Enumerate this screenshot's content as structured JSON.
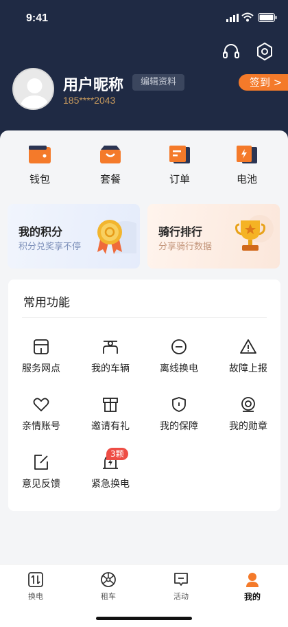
{
  "status_bar": {
    "time": "9:41"
  },
  "profile": {
    "nickname": "用户昵称",
    "edit_label": "编辑资料",
    "phone": "185****2043",
    "signin_label": "签到 >"
  },
  "quick_actions": [
    {
      "label": "钱包",
      "icon": "wallet-icon"
    },
    {
      "label": "套餐",
      "icon": "package-bag-icon"
    },
    {
      "label": "订单",
      "icon": "order-icon"
    },
    {
      "label": "电池",
      "icon": "battery-icon"
    }
  ],
  "cards": [
    {
      "title": "我的积分",
      "subtitle": "积分兑奖享不停",
      "icon": "medal-icon"
    },
    {
      "title": "骑行排行",
      "subtitle": "分享骑行数据",
      "icon": "trophy-icon"
    }
  ],
  "common": {
    "title": "常用功能",
    "items": [
      {
        "label": "服务网点",
        "icon": "store-icon"
      },
      {
        "label": "我的车辆",
        "icon": "vehicle-icon"
      },
      {
        "label": "离线换电",
        "icon": "offline-swap-icon"
      },
      {
        "label": "故障上报",
        "icon": "warning-icon"
      },
      {
        "label": "亲情账号",
        "icon": "heart-icon"
      },
      {
        "label": "邀请有礼",
        "icon": "gift-icon"
      },
      {
        "label": "我的保障",
        "icon": "shield-icon"
      },
      {
        "label": "我的勋章",
        "icon": "badge-medal-icon"
      },
      {
        "label": "意见反馈",
        "icon": "feedback-icon"
      },
      {
        "label": "紧急换电",
        "icon": "emergency-swap-icon"
      }
    ],
    "emergency_badge": "3颗"
  },
  "tabbar": [
    {
      "label": "换电",
      "icon": "swap-icon"
    },
    {
      "label": "租车",
      "icon": "wheel-icon"
    },
    {
      "label": "活动",
      "icon": "activity-icon"
    },
    {
      "label": "我的",
      "icon": "user-icon",
      "active": true
    }
  ],
  "colors": {
    "header_bg": "#1f2a44",
    "accent_orange": "#f47a2a",
    "badge_red": "#ee4d45",
    "phone_gold": "#c79a5d"
  }
}
